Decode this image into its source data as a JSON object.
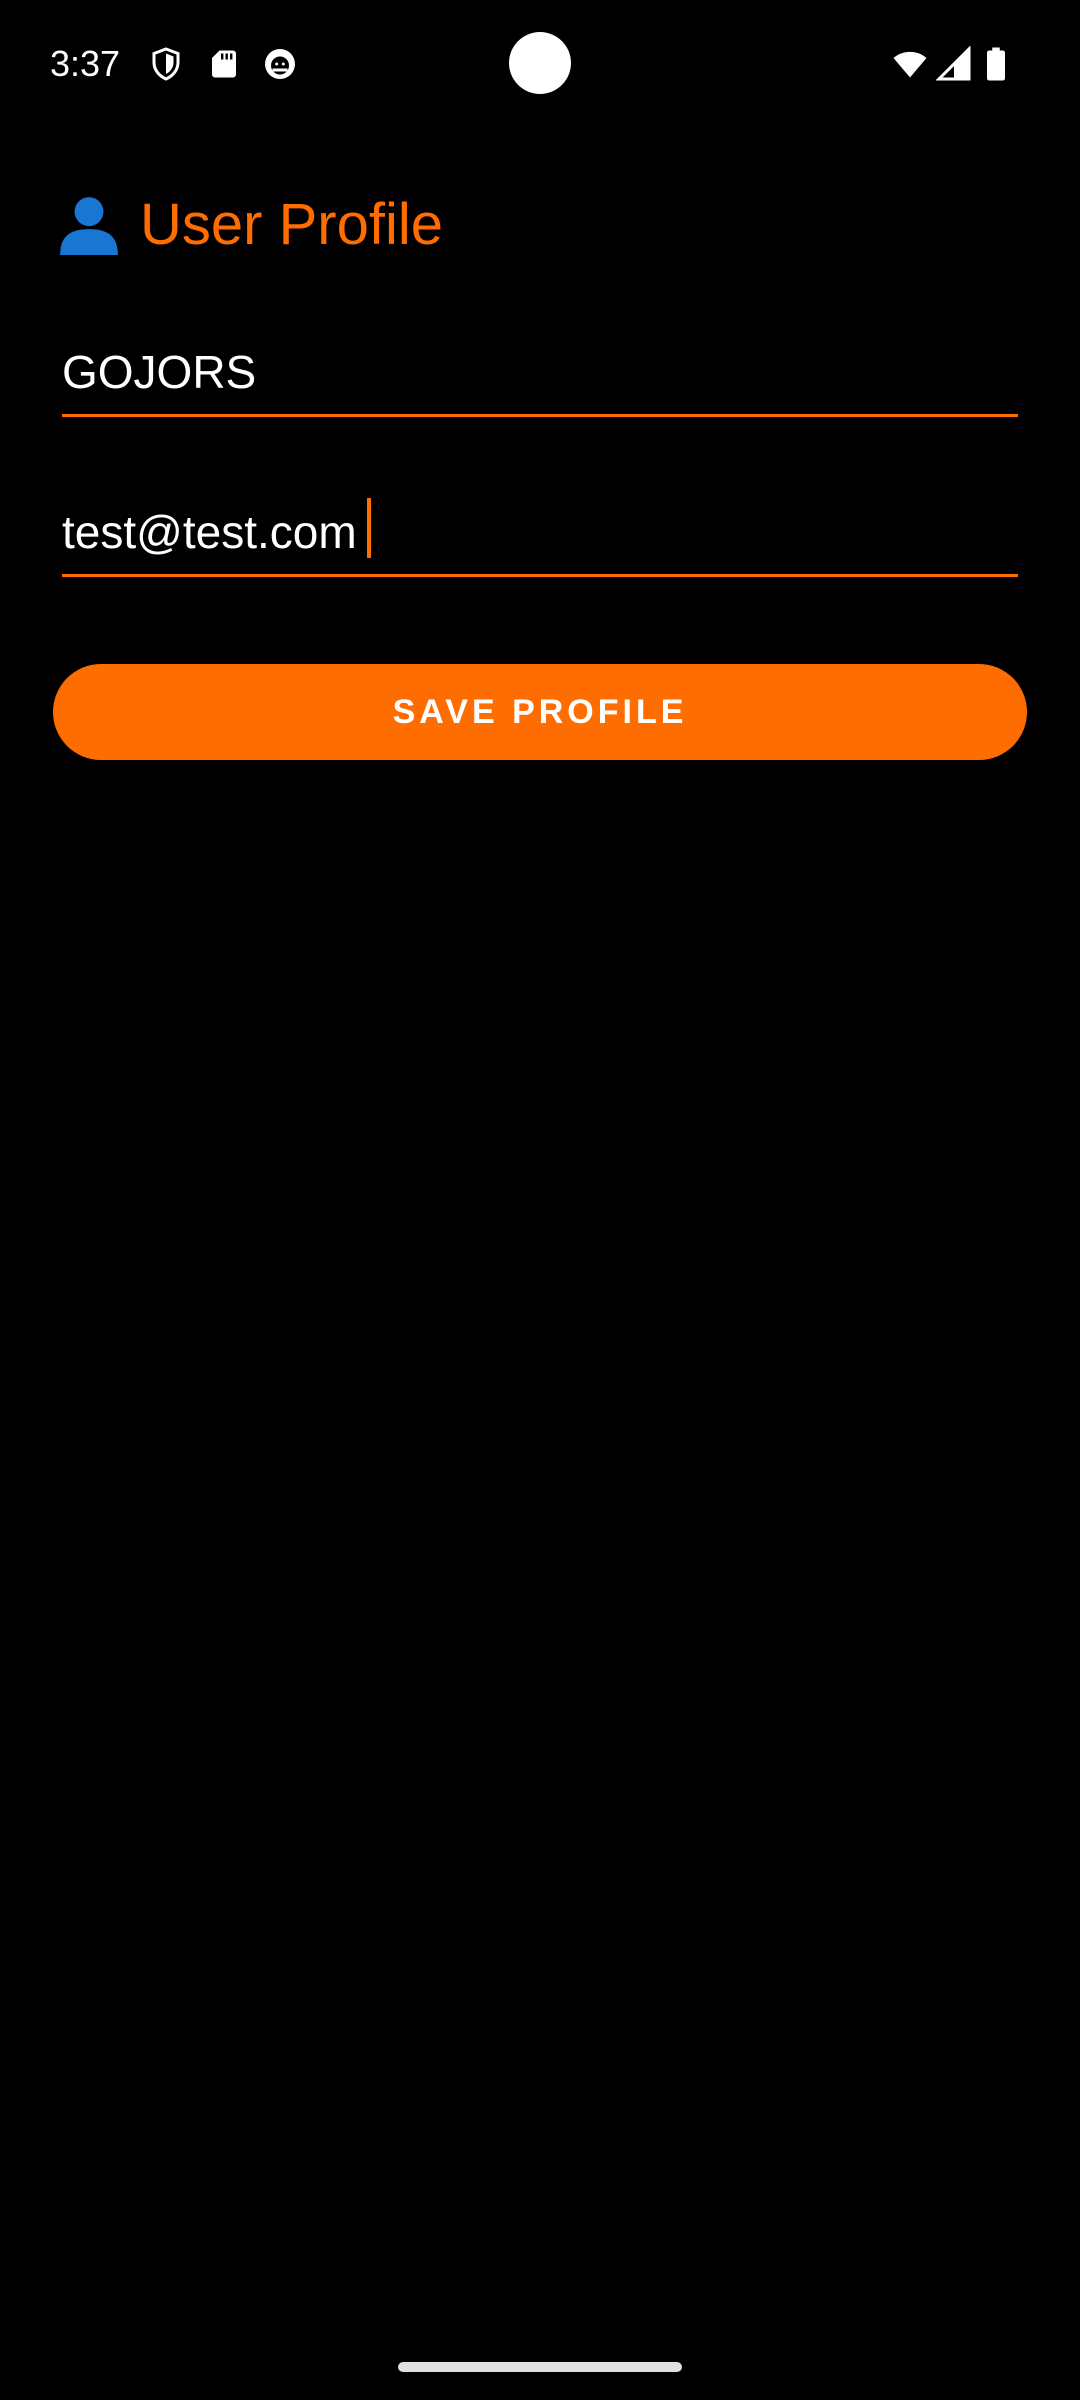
{
  "status_bar": {
    "time": "3:37",
    "left_icons": [
      "shield-icon",
      "sd-card-icon",
      "android-debug-icon"
    ],
    "right_icons": [
      "wifi-icon",
      "cell-signal-icon",
      "battery-icon"
    ]
  },
  "header": {
    "icon": "user-icon",
    "title": "User Profile"
  },
  "form": {
    "name_value": "GOJORS",
    "email_value": "test@test.com",
    "save_label": "SAVE PROFILE"
  },
  "colors": {
    "accent": "#ff6d00",
    "background": "#000000",
    "text": "#ffffff",
    "user_icon": "#1976d2"
  }
}
